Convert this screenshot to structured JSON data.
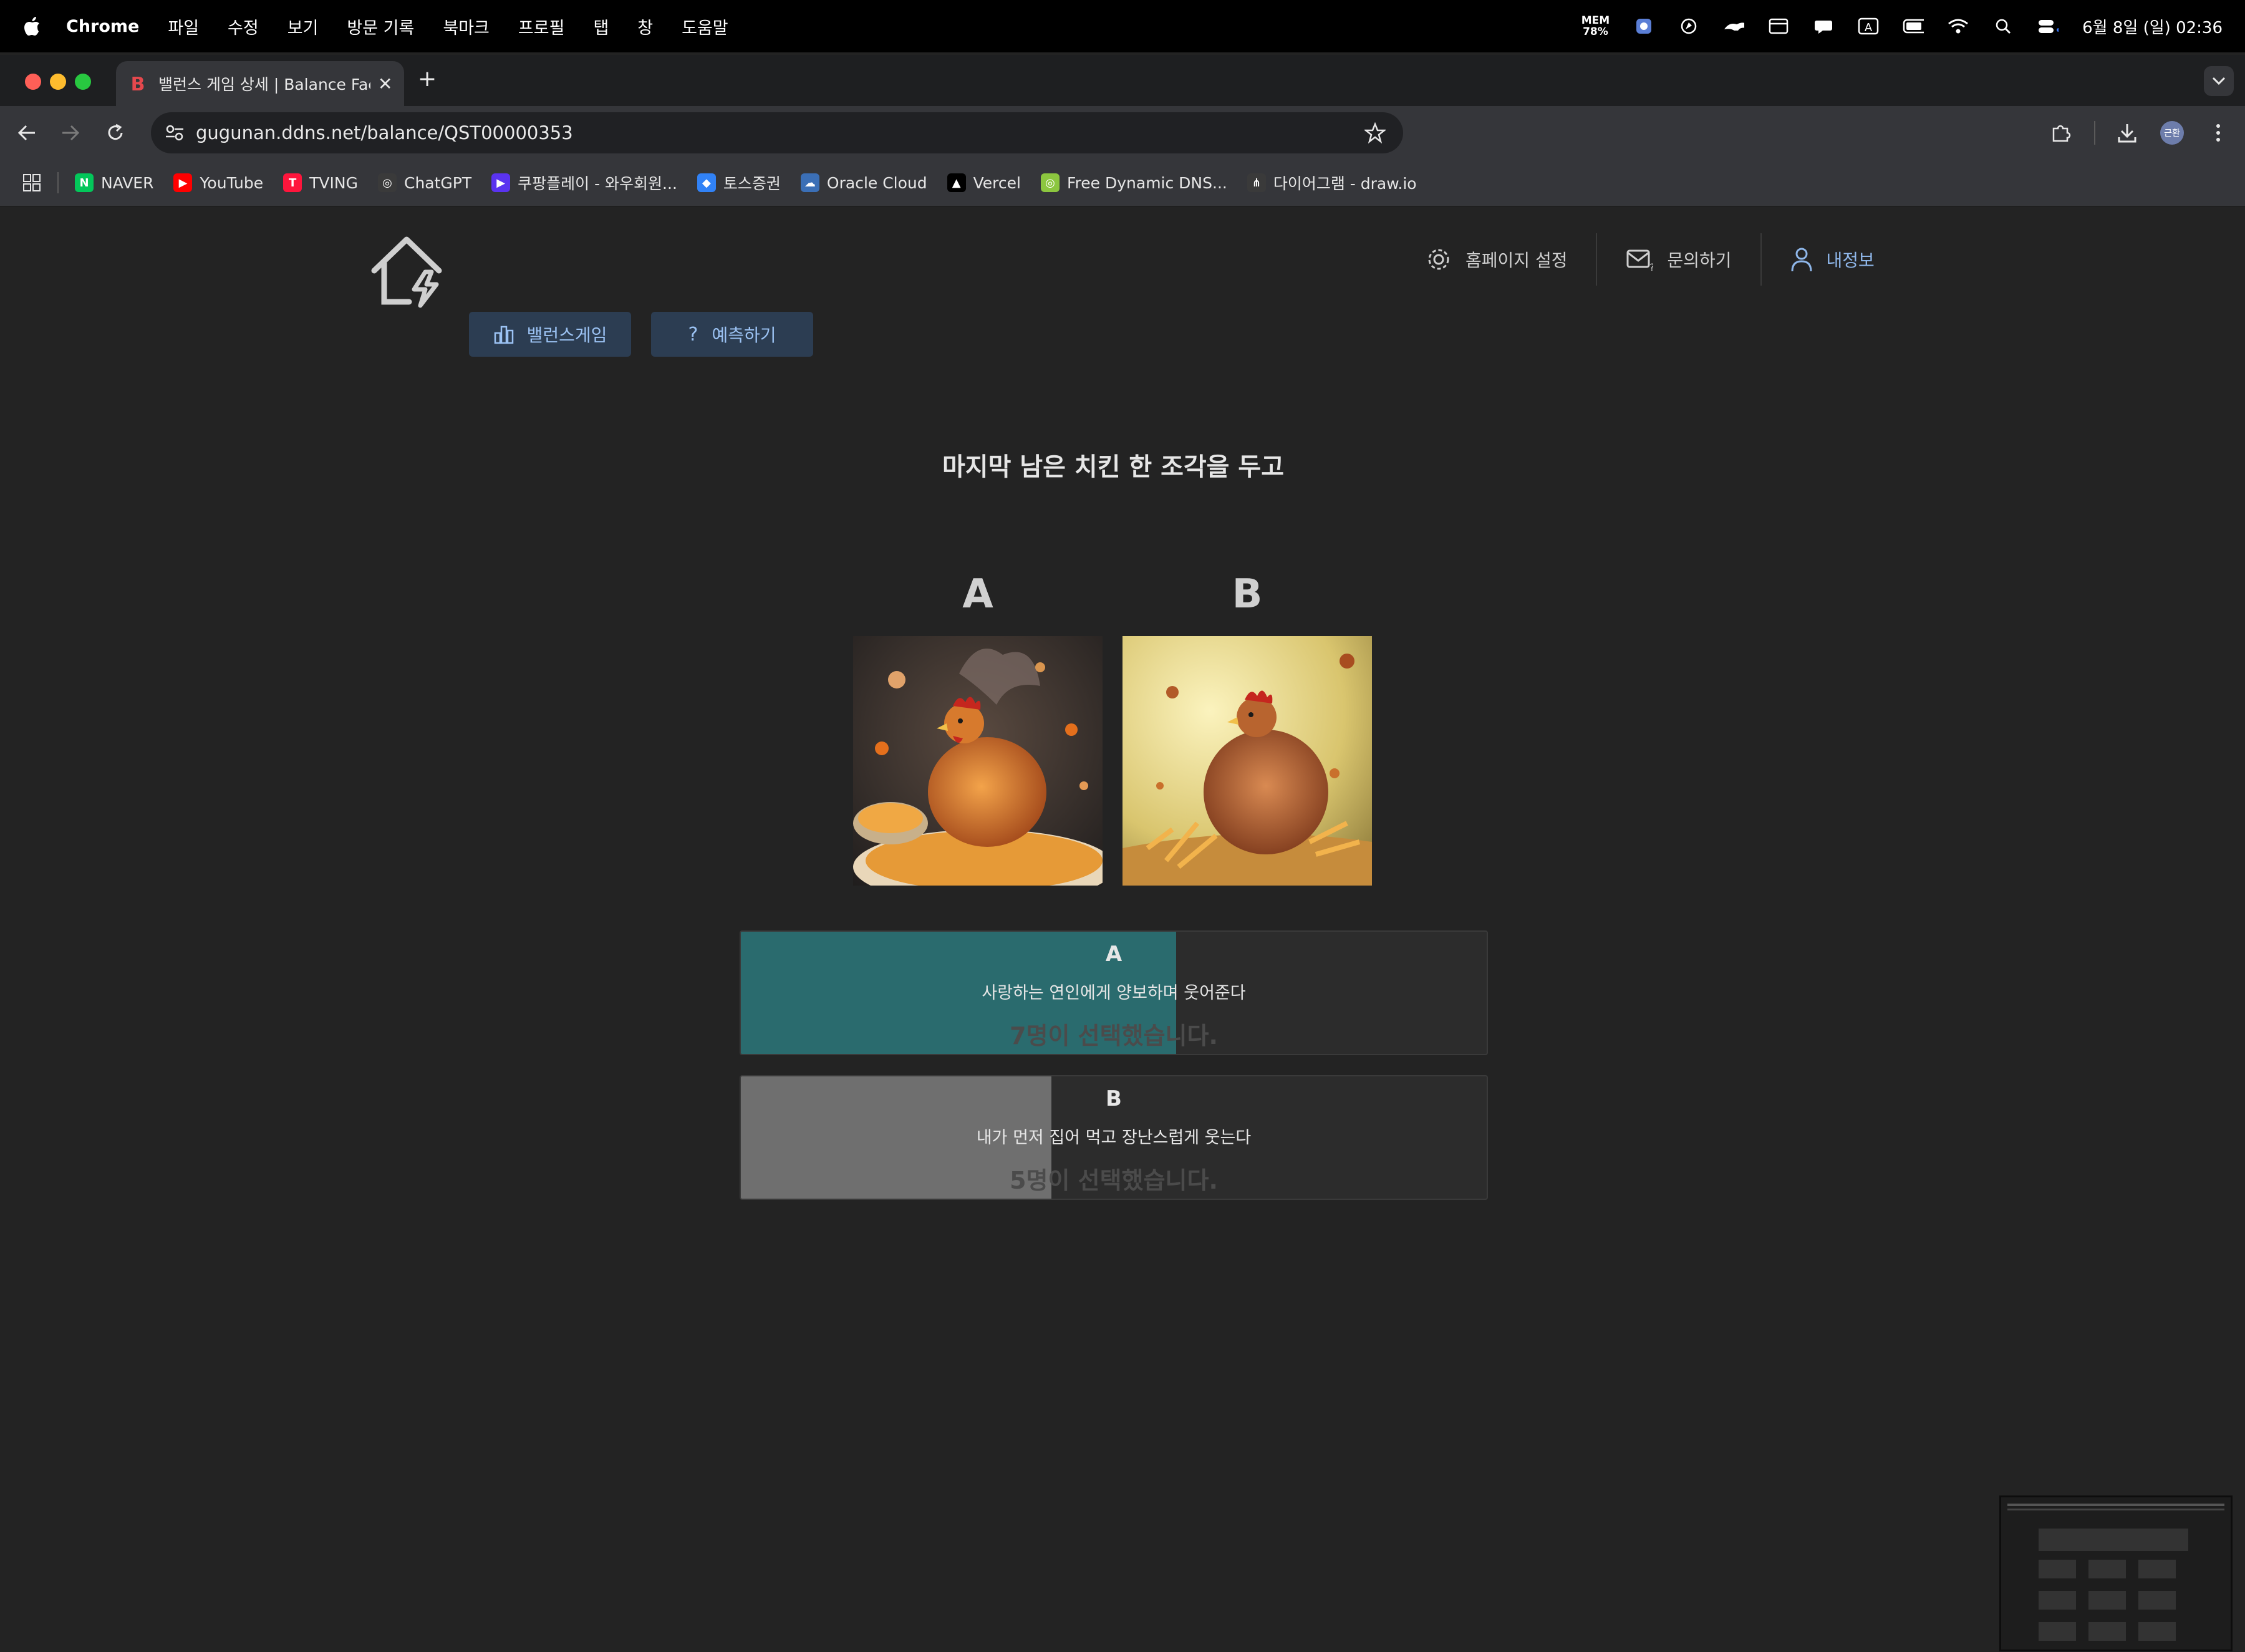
{
  "menubar": {
    "app": "Chrome",
    "items": [
      "파일",
      "수정",
      "보기",
      "방문 기록",
      "북마크",
      "프로필",
      "탭",
      "창",
      "도움말"
    ],
    "mem_label": "MEM",
    "mem_value": "78%",
    "datetime": "6월 8일 (일) 02:36"
  },
  "browser": {
    "tab_title": "밸런스 게임 상세 | Balance Factory",
    "url": "gugunan.ddns.net/balance/QST00000353",
    "profile_label": "근환",
    "bookmarks": [
      {
        "label": "NAVER",
        "color": "#03c75a",
        "glyph": "N"
      },
      {
        "label": "YouTube",
        "color": "#ff0000",
        "glyph": "▶"
      },
      {
        "label": "TVING",
        "color": "#ff153c",
        "glyph": "T"
      },
      {
        "label": "ChatGPT",
        "color": "#3a3a3a",
        "glyph": "◎"
      },
      {
        "label": "쿠팡플레이 - 와우회원...",
        "color": "#5a33f0",
        "glyph": "▶"
      },
      {
        "label": "토스증권",
        "color": "#3182f6",
        "glyph": "◆"
      },
      {
        "label": "Oracle Cloud",
        "color": "#3b6fb6",
        "glyph": "☁"
      },
      {
        "label": "Vercel",
        "color": "#000000",
        "glyph": "▲"
      },
      {
        "label": "Free Dynamic DNS...",
        "color": "#8cc63f",
        "glyph": "◎"
      },
      {
        "label": "다이어그램 - draw.io",
        "color": "#3a3a3a",
        "glyph": "⋔"
      }
    ]
  },
  "site": {
    "nav": {
      "settings": "홈페이지 설정",
      "contact": "문의하기",
      "profile": "내정보"
    },
    "menu": {
      "balance_game": "밸런스게임",
      "predict": "예측하기"
    }
  },
  "question": {
    "title": "마지막 남은 치킨 한 조각을 두고",
    "options": [
      {
        "label": "A",
        "text": "사랑하는 연인에게 양보하며 웃어준다",
        "count_text": "7명이 선택했습니다.",
        "votes": 7,
        "color": "#2a6b6e"
      },
      {
        "label": "B",
        "text": "내가 먼저 집어 먹고 장난스럽게 웃는다",
        "count_text": "5명이 선택했습니다.",
        "votes": 5,
        "color": "#6f6f6f"
      }
    ]
  }
}
